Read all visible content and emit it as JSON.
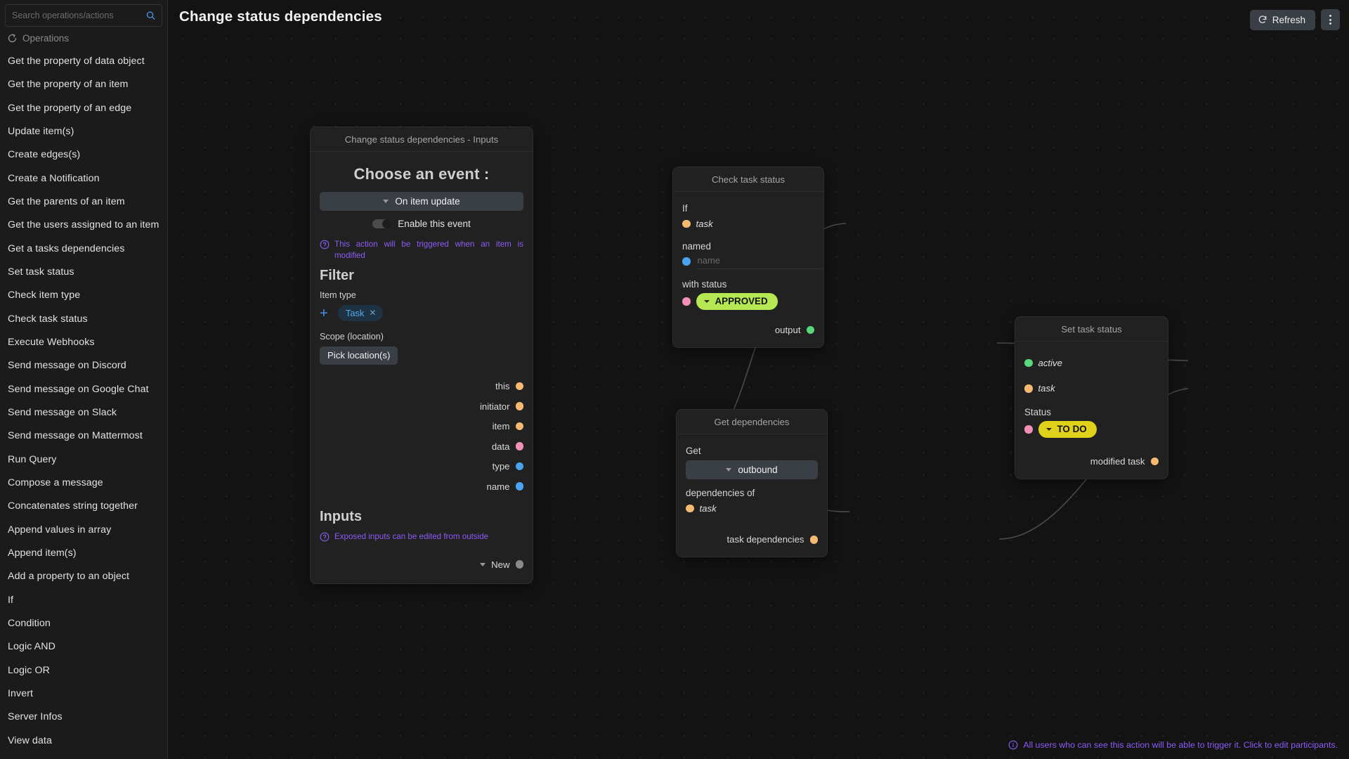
{
  "header": {
    "title": "Change status dependencies",
    "refresh_label": "Refresh",
    "refresh_icon": "refresh-icon",
    "kebab_icon": "more-vertical-icon"
  },
  "sidebar": {
    "search": {
      "placeholder": "Search operations/actions",
      "value": "",
      "icon": "search-icon"
    },
    "section_label": "Operations",
    "section_icon": "operations-icon",
    "items": [
      {
        "label": "Get the property of data object"
      },
      {
        "label": "Get the property of an item"
      },
      {
        "label": "Get the property of an edge"
      },
      {
        "label": "Update item(s)"
      },
      {
        "label": "Create edges(s)"
      },
      {
        "label": "Create a Notification"
      },
      {
        "label": "Get the parents of an item"
      },
      {
        "label": "Get the users assigned to an item"
      },
      {
        "label": "Get a tasks dependencies"
      },
      {
        "label": "Set task status"
      },
      {
        "label": "Check item type"
      },
      {
        "label": "Check task status"
      },
      {
        "label": "Execute Webhooks"
      },
      {
        "label": "Send message on Discord"
      },
      {
        "label": "Send message on Google Chat"
      },
      {
        "label": "Send message on Slack"
      },
      {
        "label": "Send message on Mattermost"
      },
      {
        "label": "Run Query"
      },
      {
        "label": "Compose a message"
      },
      {
        "label": "Concatenates string together"
      },
      {
        "label": "Append values in array"
      },
      {
        "label": "Append item(s)"
      },
      {
        "label": "Add a property to an object"
      },
      {
        "label": "If"
      },
      {
        "label": "Condition"
      },
      {
        "label": "Logic AND"
      },
      {
        "label": "Logic OR"
      },
      {
        "label": "Invert"
      },
      {
        "label": "Server Infos"
      },
      {
        "label": "View data"
      }
    ]
  },
  "nodes": {
    "inputs_node": {
      "title": "Change status dependencies - Inputs",
      "event_heading": "Choose an event :",
      "event_value": "On item update",
      "enable_toggle_label": "Enable this event",
      "enable_toggle_on": false,
      "trigger_hint": "This action will be triggered when an item is modified",
      "filter_heading": "Filter",
      "item_type_label": "Item type",
      "item_type_chips": [
        {
          "label": "Task"
        }
      ],
      "add_icon": "plus-icon",
      "scope_label": "Scope (location)",
      "scope_button": "Pick location(s)",
      "outputs": [
        {
          "label": "this",
          "color": "#f5b971"
        },
        {
          "label": "initiator",
          "color": "#f5b971"
        },
        {
          "label": "item",
          "color": "#f5b971"
        },
        {
          "label": "data",
          "color": "#f48fb7"
        },
        {
          "label": "type",
          "color": "#4aa3f0"
        },
        {
          "label": "name",
          "color": "#4aa3f0"
        }
      ],
      "inputs_heading": "Inputs",
      "inputs_hint": "Exposed inputs can be edited from outside",
      "new_label": "New",
      "new_color": "#8a8a8a"
    },
    "check_task_status": {
      "title": "Check task status",
      "if_label": "If",
      "if_port": {
        "label": "task",
        "color": "#f5b971"
      },
      "named_label": "named",
      "name_port_color": "#4aa3f0",
      "name_placeholder": "name",
      "name_value": "",
      "with_status_label": "with status",
      "status_port_color": "#f48fb7",
      "status_value": "APPROVED",
      "status_color": "#b5e853",
      "output_label": "output",
      "output_color": "#5cd67c"
    },
    "get_dependencies": {
      "title": "Get dependencies",
      "get_label": "Get",
      "direction_value": "outbound",
      "dependencies_of_label": "dependencies of",
      "task_port": {
        "label": "task",
        "color": "#f5b971"
      },
      "output_label": "task dependencies",
      "output_color": "#f5b971"
    },
    "set_task_status": {
      "title": "Set task status",
      "active_port": {
        "label": "active",
        "color": "#5cd67c"
      },
      "task_port": {
        "label": "task",
        "color": "#f5b971"
      },
      "status_label": "Status",
      "status_port_color": "#f48fb7",
      "status_value": "TO DO",
      "status_color": "#e0d21a",
      "output_label": "modified task",
      "output_color": "#f5b971"
    }
  },
  "footer": {
    "note": "All users who can see this action will be able to trigger it. Click to edit participants.",
    "icon": "info-icon"
  }
}
